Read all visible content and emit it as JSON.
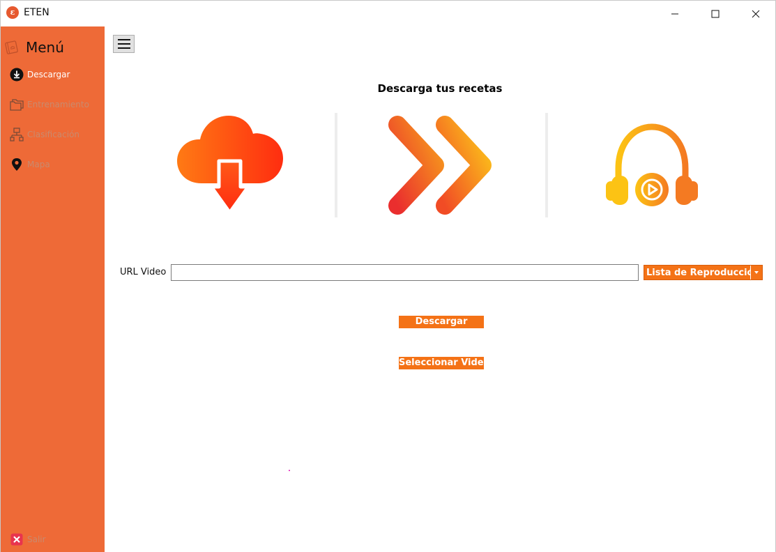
{
  "window": {
    "title": "ETEN",
    "icon_letter": "ε",
    "icons": {
      "minimize": "minimize-icon",
      "maximize": "maximize-icon",
      "close": "close-icon"
    }
  },
  "sidebar": {
    "title": "Menú",
    "title_icon": "recipe-book-icon",
    "items": [
      {
        "label": "Descargar",
        "icon": "download-circle-icon",
        "active": true
      },
      {
        "label": "Entrenamiento",
        "icon": "folders-icon",
        "active": false
      },
      {
        "label": "Clasificación",
        "icon": "sitemap-icon",
        "active": false
      },
      {
        "label": "Mapa",
        "icon": "map-pin-icon",
        "active": false
      }
    ],
    "exit": {
      "label": "Salir",
      "icon": "exit-x-icon"
    }
  },
  "main": {
    "menu_toggle_icon": "hamburger-icon",
    "heading": "Descarga tus recetas",
    "illustrations": [
      "cloud-download-icon",
      "double-chevron-right-icon",
      "headphones-play-icon"
    ],
    "url_field": {
      "label": "URL Video",
      "value": "",
      "placeholder": ""
    },
    "mode_select": {
      "value": "Lista de Reproducció",
      "icon": "chevron-down-icon"
    },
    "download_button": "Descargar",
    "select_video_button": "Seleccionar Video"
  },
  "colors": {
    "sidebar": "#ee6a37",
    "accent": "#f47216",
    "inactive_text": "#c98a6e"
  }
}
